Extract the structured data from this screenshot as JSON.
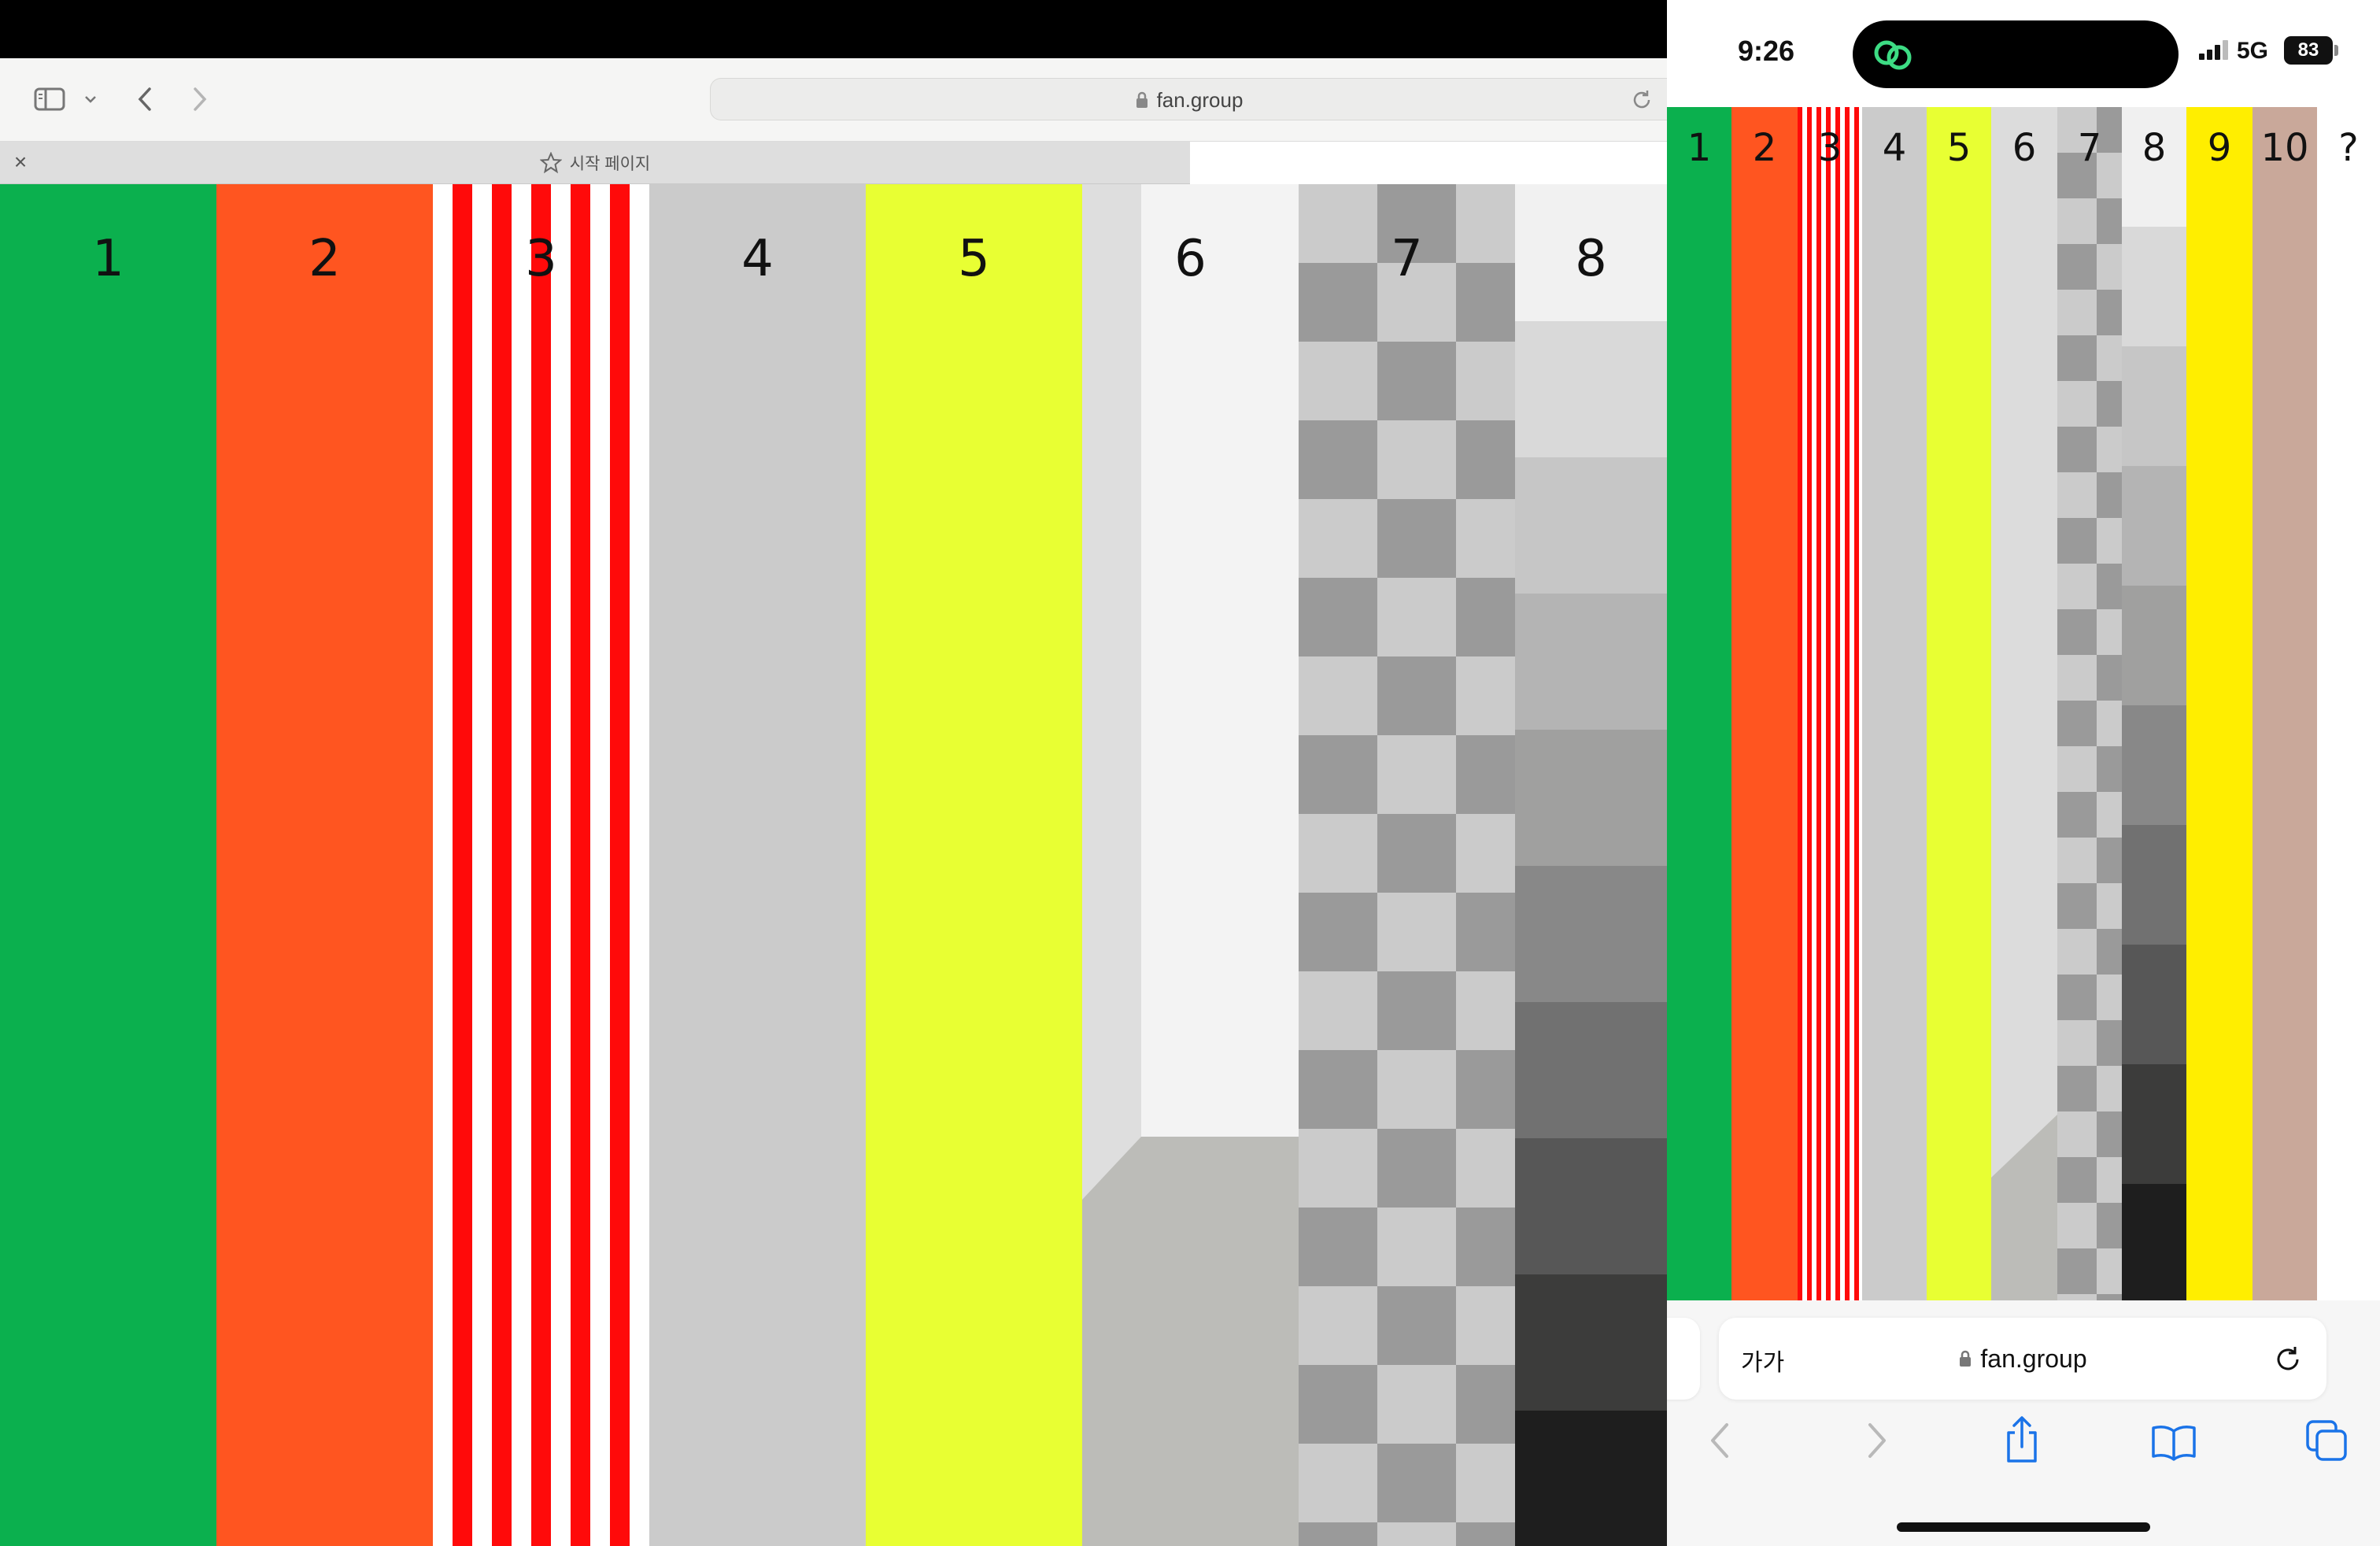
{
  "mac_browser": {
    "url": "fan.group",
    "tab_title": "시작 페이지"
  },
  "mac_columns": [
    {
      "label": "1",
      "color": "#0bb04e",
      "pattern": "solid"
    },
    {
      "label": "2",
      "color": "#ff5520",
      "pattern": "solid"
    },
    {
      "label": "3",
      "color": "#ff0a0a",
      "pattern": "red-white-stripes"
    },
    {
      "label": "4",
      "color": "#cbcbcb",
      "pattern": "solid"
    },
    {
      "label": "5",
      "color": "#e8ff33",
      "pattern": "solid"
    },
    {
      "label": "6",
      "color": "#f3f3f3",
      "pattern": "perspective-corner"
    },
    {
      "label": "7",
      "color": "#9a9a9a",
      "pattern": "checkerboard"
    },
    {
      "label": "8",
      "color": "#1e1e1e",
      "pattern": "grayscale-steps"
    }
  ],
  "phone": {
    "status": {
      "time": "9:26",
      "network": "5G",
      "battery": "83"
    },
    "columns": [
      {
        "label": "1",
        "color": "#0bb04e"
      },
      {
        "label": "2",
        "color": "#ff5520"
      },
      {
        "label": "3",
        "color": "#ff0a0a"
      },
      {
        "label": "4",
        "color": "#cbcbcb"
      },
      {
        "label": "5",
        "color": "#e8ff33"
      },
      {
        "label": "6",
        "color": "#dcdcdc"
      },
      {
        "label": "7",
        "color": "#9a9a9a"
      },
      {
        "label": "8",
        "color": "#2a2a2a"
      },
      {
        "label": "9",
        "color": "#ffee00"
      },
      {
        "label": "10",
        "color": "#c9a89a"
      },
      {
        "label": "?",
        "color": "#ffffff"
      }
    ],
    "address_bar": {
      "text_size_label": "가가",
      "url": "fan.group"
    },
    "toolbar_icons": [
      "back-icon",
      "forward-icon",
      "share-icon",
      "bookmarks-icon",
      "tabs-icon"
    ]
  }
}
